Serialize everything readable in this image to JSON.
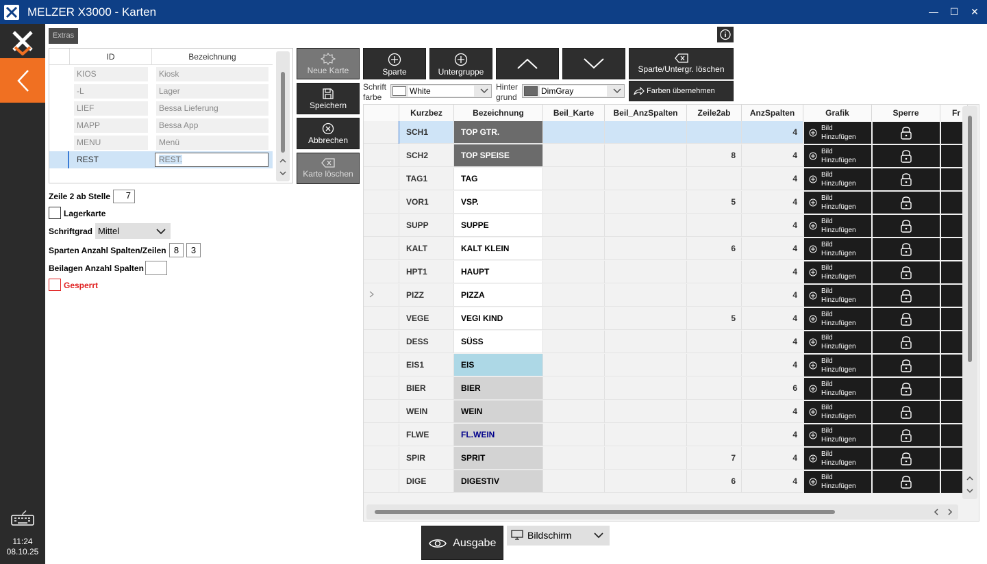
{
  "window": {
    "title": "MELZER X3000 - Karten",
    "minimize": "—",
    "maximize": "☐",
    "close": "✕"
  },
  "rail": {
    "time": "11:24",
    "date": "08.10.25"
  },
  "extras_label": "Extras",
  "left_table": {
    "headers": [
      "ID",
      "Bezeichnung"
    ],
    "rows": [
      {
        "id": "KIOS",
        "name": "Kiosk"
      },
      {
        "id": "-L",
        "name": "Lager"
      },
      {
        "id": "LIEF",
        "name": "Bessa Lieferung"
      },
      {
        "id": "MAPP",
        "name": "Bessa App"
      },
      {
        "id": "MENU",
        "name": "Menü"
      },
      {
        "id": "REST",
        "name": "REST."
      }
    ]
  },
  "form": {
    "zeile2_label": "Zeile 2 ab Stelle",
    "zeile2_value": "7",
    "lagerkarte_label": "Lagerkarte",
    "schriftgrad_label": "Schriftgrad",
    "schriftgrad_value": "Mittel",
    "sparten_label": "Sparten Anzahl Spalten/Zeilen",
    "sparten_cols": "8",
    "sparten_rows": "3",
    "beilagen_label": "Beilagen Anzahl Spalten",
    "beilagen_value": "",
    "gesperrt_label": "Gesperrt"
  },
  "buttons": {
    "neue_karte": "Neue Karte",
    "speichern": "Speichern",
    "abbrechen": "Abbrechen",
    "karte_loeschen": "Karte löschen",
    "sparte": "Sparte",
    "untergruppe": "Untergruppe",
    "sparte_loeschen": "Sparte/Untergr. löschen",
    "farben": "Farben übernehmen",
    "ausgabe": "Ausgabe",
    "bildschirm": "Bildschirm"
  },
  "colors": {
    "schrift_label_1": "Schrift",
    "schrift_label_2": "farbe",
    "schrift_value": "White",
    "hinter_label_1": "Hinter",
    "hinter_label_2": "grund",
    "hinter_value": "DimGray"
  },
  "grid": {
    "headers": [
      "Kurzbez",
      "Bezeichnung",
      "Beil_Karte",
      "Beil_AnzSpalten",
      "Zeile2ab",
      "AnzSpalten",
      "Grafik",
      "Sperre",
      "Fr"
    ],
    "bild_label_1": "Bild",
    "bild_label_2": "Hinzufügen",
    "rows": [
      {
        "k": "SCH1",
        "b": "TOP GTR.",
        "z": "",
        "a": "4"
      },
      {
        "k": "SCH2",
        "b": "TOP SPEISE",
        "z": "8",
        "a": "4"
      },
      {
        "k": "TAG1",
        "b": "TAG",
        "z": "",
        "a": "4"
      },
      {
        "k": "VOR1",
        "b": "VSP.",
        "z": "5",
        "a": "4"
      },
      {
        "k": "SUPP",
        "b": "SUPPE",
        "z": "",
        "a": "4"
      },
      {
        "k": "KALT",
        "b": "KALT KLEIN",
        "z": "6",
        "a": "4"
      },
      {
        "k": "HPT1",
        "b": "HAUPT",
        "z": "",
        "a": "4"
      },
      {
        "k": "PIZZ",
        "b": "PIZZA",
        "z": "",
        "a": "4"
      },
      {
        "k": "VEGE",
        "b": "VEGI KIND",
        "z": "5",
        "a": "4"
      },
      {
        "k": "DESS",
        "b": "SÜSS",
        "z": "",
        "a": "4"
      },
      {
        "k": "EIS1",
        "b": "EIS",
        "z": "",
        "a": "4"
      },
      {
        "k": "BIER",
        "b": "BIER",
        "z": "",
        "a": "6"
      },
      {
        "k": "WEIN",
        "b": "WEIN",
        "z": "",
        "a": "4"
      },
      {
        "k": "FLWE",
        "b": "FL.WEIN",
        "z": "",
        "a": "4"
      },
      {
        "k": "SPIR",
        "b": "SPRIT",
        "z": "7",
        "a": "4"
      },
      {
        "k": "DIGE",
        "b": "DIGESTIV",
        "z": "6",
        "a": "4"
      }
    ]
  }
}
